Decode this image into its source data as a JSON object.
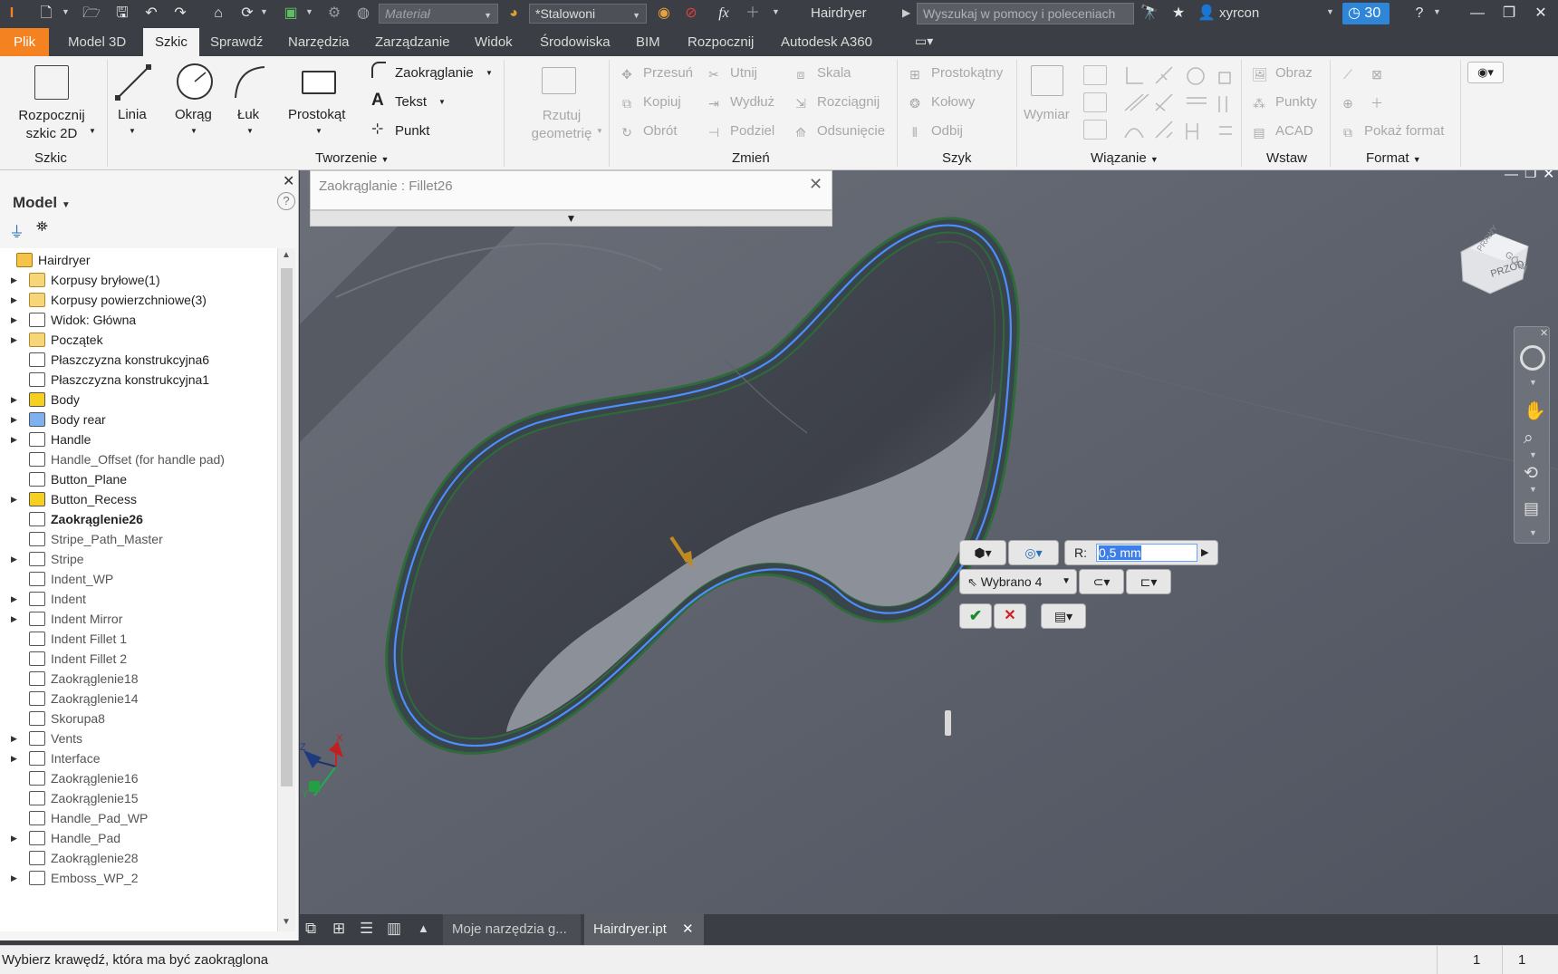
{
  "titlebar": {
    "material_placeholder": "Materiał",
    "appearance_value": "*Stalowoni",
    "document_title": "Hairdryer",
    "search_placeholder": "Wyszukaj w pomocy i poleceniach",
    "user_name": "xyrcon",
    "trial_badge": "30",
    "fx_label": "fx"
  },
  "tabs": [
    "Plik",
    "Model 3D",
    "Szkic",
    "Sprawdź",
    "Narzędzia",
    "Zarządzanie",
    "Widok",
    "Środowiska",
    "BIM",
    "Rozpocznij",
    "Autodesk A360"
  ],
  "ribbon": {
    "start_sketch": "Rozpocznij\nszkic 2D",
    "start_sketch_line1": "Rozpocznij",
    "start_sketch_line2": "szkic 2D",
    "line": "Linia",
    "circle": "Okrąg",
    "arc": "Łuk",
    "rectangle": "Prostokąt",
    "fillet": "Zaokrąglanie",
    "text": "Tekst",
    "point": "Punkt",
    "project_line1": "Rzutuj",
    "project_line2": "geometrię",
    "move": "Przesuń",
    "copy": "Kopiuj",
    "rotate": "Obrót",
    "trim": "Utnij",
    "extend": "Wydłuż",
    "split": "Podziel",
    "scale": "Skala",
    "stretch": "Rozciągnij",
    "offset": "Odsunięcie",
    "rect_pattern": "Prostokątny",
    "circ_pattern": "Kołowy",
    "mirror": "Odbij",
    "dimension": "Wymiar",
    "image": "Obraz",
    "points": "Punkty",
    "acad": "ACAD",
    "show_format": "Pokaż format",
    "groups": {
      "sketch": "Szkic",
      "create": "Tworzenie",
      "modify": "Zmień",
      "pattern": "Szyk",
      "constrain": "Wiązanie",
      "insert": "Wstaw",
      "format": "Format"
    }
  },
  "browser": {
    "title": "Model",
    "items": [
      {
        "label": "Hairdryer",
        "expand": false,
        "bold": false,
        "gray": false
      },
      {
        "label": "Korpusy bryłowe(1)",
        "expand": true
      },
      {
        "label": "Korpusy powierzchniowe(3)",
        "expand": true
      },
      {
        "label": "Widok: Główna",
        "expand": true
      },
      {
        "label": "Początek",
        "expand": true
      },
      {
        "label": "Płaszczyzna konstrukcyjna6",
        "expand": false
      },
      {
        "label": "Płaszczyzna konstrukcyjna1",
        "expand": false
      },
      {
        "label": "Body",
        "expand": true
      },
      {
        "label": "Body rear",
        "expand": true
      },
      {
        "label": "Handle",
        "expand": true
      },
      {
        "label": "Handle_Offset (for handle pad)",
        "expand": false,
        "gray": true
      },
      {
        "label": "Button_Plane",
        "expand": false
      },
      {
        "label": "Button_Recess",
        "expand": true
      },
      {
        "label": "Zaokrąglenie26",
        "expand": false,
        "bold": true
      },
      {
        "label": "Stripe_Path_Master",
        "expand": false,
        "gray": true
      },
      {
        "label": "Stripe",
        "expand": true,
        "gray": true
      },
      {
        "label": "Indent_WP",
        "expand": false,
        "gray": true
      },
      {
        "label": "Indent",
        "expand": true,
        "gray": true
      },
      {
        "label": "Indent Mirror",
        "expand": true,
        "gray": true
      },
      {
        "label": "Indent Fillet 1",
        "expand": false,
        "gray": true
      },
      {
        "label": "Indent Fillet 2",
        "expand": false,
        "gray": true
      },
      {
        "label": "Zaokrąglenie18",
        "expand": false,
        "gray": true
      },
      {
        "label": "Zaokrąglenie14",
        "expand": false,
        "gray": true
      },
      {
        "label": "Skorupa8",
        "expand": false,
        "gray": true
      },
      {
        "label": "Vents",
        "expand": true,
        "gray": true
      },
      {
        "label": "Interface",
        "expand": true,
        "gray": true
      },
      {
        "label": "Zaokrąglenie16",
        "expand": false,
        "gray": true
      },
      {
        "label": "Zaokrąglenie15",
        "expand": false,
        "gray": true
      },
      {
        "label": "Handle_Pad_WP",
        "expand": false,
        "gray": true
      },
      {
        "label": "Handle_Pad",
        "expand": true,
        "gray": true
      },
      {
        "label": "Zaokrąglenie28",
        "expand": false,
        "gray": true
      },
      {
        "label": "Emboss_WP_2",
        "expand": true,
        "gray": true
      }
    ]
  },
  "dialog": {
    "title": "Zaokrąglanie : Fillet26"
  },
  "minitoolbar": {
    "radius_label": "R:",
    "radius_value": "0,5 mm",
    "selected_label": "Wybrano 4"
  },
  "doc_tabs": [
    "Moje narzędzia g...",
    "Hairdryer.ipt"
  ],
  "status": {
    "message": "Wybierz krawędź, która ma być zaokrąglona",
    "count1": "1",
    "count2": "1"
  },
  "viewcube": {
    "front": "PRZÓD",
    "top": "GÓRA",
    "right": "PRAWY"
  },
  "colors": {
    "accent": "#f58220",
    "selection": "#4d8fff",
    "edge_green": "#2f6b3a",
    "viewport_bg": "#5c6069"
  }
}
